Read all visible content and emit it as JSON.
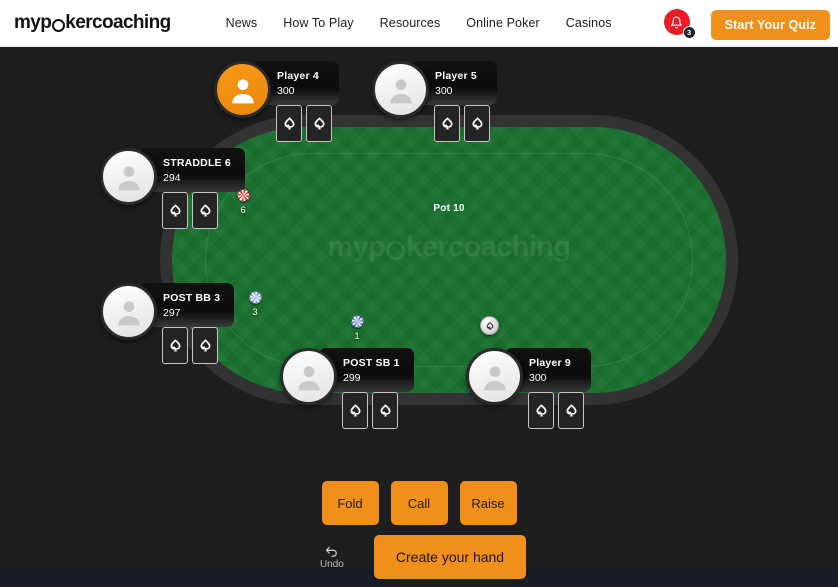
{
  "header": {
    "logo": {
      "pre": "myp",
      "ring": "o",
      "post": "kercoaching"
    },
    "nav": [
      {
        "label": "News"
      },
      {
        "label": "How To Play"
      },
      {
        "label": "Resources"
      },
      {
        "label": "Online Poker"
      },
      {
        "label": "Casinos"
      }
    ],
    "notification": {
      "icon": "bell-icon",
      "count": "3"
    },
    "cta": {
      "label": "Start Your Quiz"
    },
    "colors": {
      "accent": "#f0901a",
      "bell": "#ec1c24",
      "text": "#1d1d1d"
    }
  },
  "table": {
    "pot_label": "Pot 10",
    "watermark": {
      "pre": "myp",
      "ring": "o",
      "post": "kercoaching"
    },
    "colors": {
      "felt": "#19702f",
      "rail": "#333333",
      "background": "#1e1e1e"
    },
    "dealer_button": {
      "name": "dealer-button"
    }
  },
  "seats": [
    {
      "name": "Player 4",
      "stack": "300",
      "active": true,
      "side": "left"
    },
    {
      "name": "Player 5",
      "stack": "300",
      "active": false,
      "side": "left"
    },
    {
      "name": "STRADDLE 6",
      "stack": "294",
      "active": false,
      "side": "left"
    },
    {
      "name": "POST BB 3",
      "stack": "297",
      "active": false,
      "side": "left"
    },
    {
      "name": "POST SB 1",
      "stack": "299",
      "active": false,
      "side": "left"
    },
    {
      "name": "Player 9",
      "stack": "300",
      "active": false,
      "side": "left"
    }
  ],
  "bets": [
    {
      "amount": "6",
      "chip": "red",
      "owner": "STRADDLE 6"
    },
    {
      "amount": "3",
      "chip": "white",
      "owner": "POST BB 3"
    },
    {
      "amount": "1",
      "chip": "blue",
      "owner": "POST SB 1"
    }
  ],
  "actions": [
    {
      "label": "Fold"
    },
    {
      "label": "Call"
    },
    {
      "label": "Raise"
    }
  ],
  "bottom": {
    "undo": {
      "label": "Undo",
      "icon": "undo-arrow-icon"
    },
    "create": {
      "label": "Create your hand"
    }
  }
}
